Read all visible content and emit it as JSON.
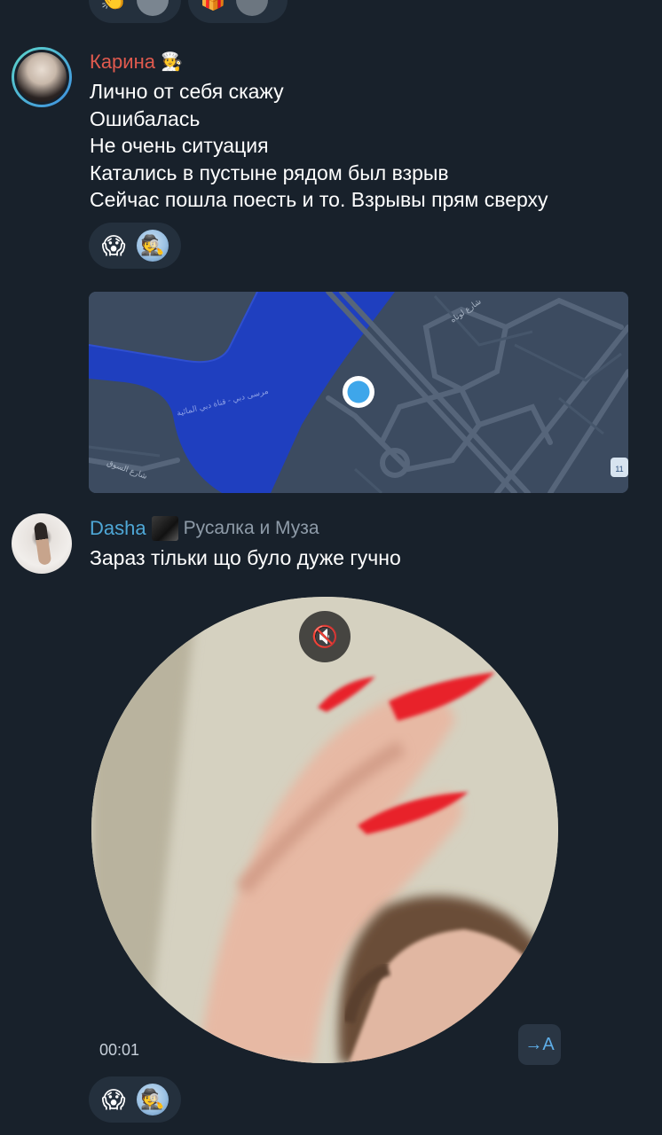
{
  "top_reactions": [
    {
      "emoji": "👏",
      "icon": "clapping-icon"
    },
    {
      "emoji": "🎁",
      "icon": "gift-icon"
    }
  ],
  "messages": [
    {
      "sender": "Карина",
      "sender_status_emoji": "🧑‍🍳",
      "lines": [
        "Лично от себя скажу",
        "Ошибалась",
        "Не очень ситуация",
        "Катались в пустыне рядом был взрыв",
        "Сейчас пошла поесть и то. Взрывы  прям сверху"
      ],
      "reactions": [
        {
          "emoji": "😱",
          "icon": "scream-emoji-icon"
        },
        {
          "emoji": "🕵️",
          "icon": "custom-avatar-emoji-icon"
        }
      ]
    },
    {
      "type": "location",
      "map_labels": [
        "شارع لوتاه",
        "مرسى دبي - قناة دبي المائية",
        "شارع السوق"
      ],
      "map_badge": "11"
    },
    {
      "sender": "Dasha",
      "sender_title": "Русалка и Муза",
      "text": "Зараз тільки що було дуже гучно",
      "video": {
        "duration": "00:01",
        "translate_label": "→A"
      },
      "reactions": [
        {
          "emoji": "😱",
          "icon": "scream-emoji-icon"
        },
        {
          "emoji": "🕵️",
          "icon": "custom-avatar-emoji-icon"
        }
      ]
    }
  ],
  "colors": {
    "background": "#18212b",
    "sender_karina": "#e05a4e",
    "sender_dasha": "#4ea7d6",
    "map_water": "#1f3fbf",
    "map_location_dot": "#3ea6ea",
    "nails": "#e8202c"
  }
}
